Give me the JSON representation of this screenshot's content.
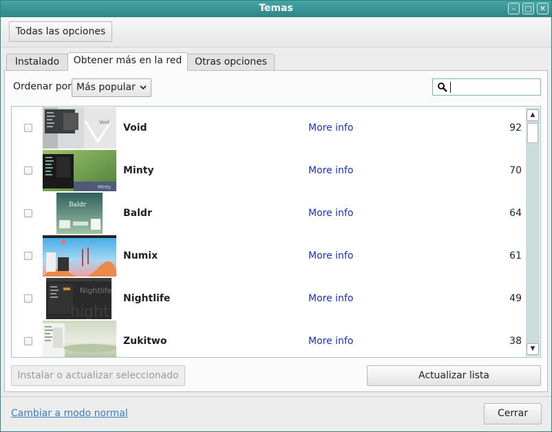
{
  "window": {
    "title": "Temas"
  },
  "toolbar": {
    "all_options_label": "Todas las opciones"
  },
  "tabs": [
    {
      "label": "Instalado"
    },
    {
      "label": "Obtener más en la red"
    },
    {
      "label": "Otras opciones"
    }
  ],
  "sort": {
    "label": "Ordenar por",
    "selected": "Más popular"
  },
  "search": {
    "value": "",
    "placeholder": ""
  },
  "themes": [
    {
      "name": "Void",
      "more": "More info",
      "count": "92"
    },
    {
      "name": "Minty",
      "more": "More info",
      "count": "70"
    },
    {
      "name": "Baldr",
      "more": "More info",
      "count": "64"
    },
    {
      "name": "Numix",
      "more": "More info",
      "count": "61"
    },
    {
      "name": "Nightlife",
      "more": "More info",
      "count": "49"
    },
    {
      "name": "Zukitwo",
      "more": "More info",
      "count": "38"
    }
  ],
  "actions": {
    "install_label": "Instalar o actualizar seleccionado",
    "update_list_label": "Actualizar lista"
  },
  "footer": {
    "mode_link": "Cambiar a modo normal",
    "close_label": "Cerrar"
  },
  "icons": {
    "minimize": "minimize-icon",
    "maximize": "maximize-icon",
    "close": "close-icon",
    "search": "search-icon",
    "dropdown": "chevron-down-icon",
    "scroll_up": "chevron-up-icon",
    "scroll_down": "chevron-down-icon"
  },
  "colors": {
    "titlebar": "#2f8585",
    "link": "#1a2fc4",
    "footer_link": "#3b7cc0"
  }
}
